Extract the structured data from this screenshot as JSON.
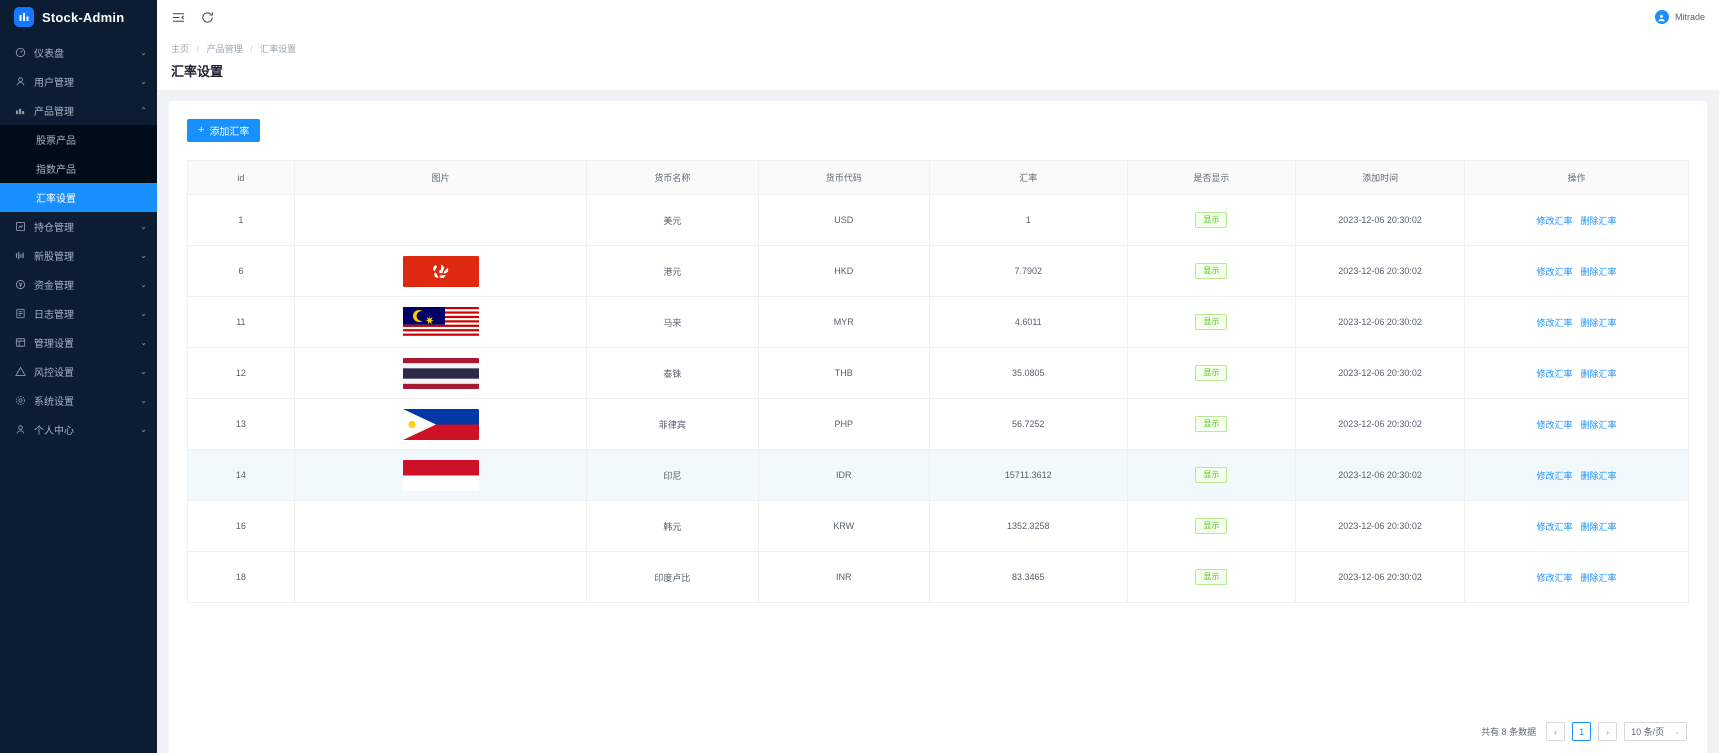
{
  "brand": {
    "name": "Stock-Admin",
    "logo_icon": "chart-logo-icon"
  },
  "sidebar": {
    "items": [
      {
        "label": "仪表盘",
        "icon": "dashboard-icon",
        "arrow": "⌄",
        "expanded": false
      },
      {
        "label": "用户管理",
        "icon": "user-icon",
        "arrow": "⌄",
        "expanded": false
      },
      {
        "label": "产品管理",
        "icon": "product-icon",
        "arrow": "⌃",
        "expanded": true
      },
      {
        "label": "持仓管理",
        "icon": "position-icon",
        "arrow": "⌄",
        "expanded": false
      },
      {
        "label": "新股管理",
        "icon": "ipo-icon",
        "arrow": "⌄",
        "expanded": false
      },
      {
        "label": "资金管理",
        "icon": "fund-icon",
        "arrow": "⌄",
        "expanded": false
      },
      {
        "label": "日志管理",
        "icon": "log-icon",
        "arrow": "⌄",
        "expanded": false
      },
      {
        "label": "管理设置",
        "icon": "manage-icon",
        "arrow": "⌄",
        "expanded": false
      },
      {
        "label": "风控设置",
        "icon": "risk-icon",
        "arrow": "⌄",
        "expanded": false
      },
      {
        "label": "系统设置",
        "icon": "system-icon",
        "arrow": "⌄",
        "expanded": false
      },
      {
        "label": "个人中心",
        "icon": "person-icon",
        "arrow": "⌄",
        "expanded": false
      }
    ],
    "submenu": [
      {
        "label": "股票产品",
        "active": false
      },
      {
        "label": "指数产品",
        "active": false
      },
      {
        "label": "汇率设置",
        "active": true
      }
    ],
    "active_color": "#1890ff"
  },
  "topbar": {
    "collapse_icon": "menu-collapse-icon",
    "refresh_icon": "refresh-icon",
    "user": {
      "name": "Mitrade",
      "avatar_icon": "user-avatar-icon"
    }
  },
  "page": {
    "breadcrumb": [
      "主页",
      "产品管理",
      "汇率设置"
    ],
    "title": "汇率设置"
  },
  "toolbar": {
    "add_label": "添加汇率",
    "add_icon": "plus-icon"
  },
  "table": {
    "columns": [
      "id",
      "图片",
      "货币名称",
      "货币代码",
      "汇率",
      "是否显示",
      "添加时间",
      "操作"
    ],
    "actions": {
      "edit": "修改汇率",
      "delete": "删除汇率"
    },
    "rows": [
      {
        "id": "1",
        "flag": "none",
        "name": "美元",
        "code": "USD",
        "rate": "1",
        "show": "显示",
        "time": "2023-12-06 20:30:02"
      },
      {
        "id": "6",
        "flag": "hk",
        "name": "港元",
        "code": "HKD",
        "rate": "7.7902",
        "show": "显示",
        "time": "2023-12-06 20:30:02"
      },
      {
        "id": "11",
        "flag": "my",
        "name": "马来",
        "code": "MYR",
        "rate": "4.6011",
        "show": "显示",
        "time": "2023-12-06 20:30:02"
      },
      {
        "id": "12",
        "flag": "th",
        "name": "泰铢",
        "code": "THB",
        "rate": "35.0805",
        "show": "显示",
        "time": "2023-12-06 20:30:02"
      },
      {
        "id": "13",
        "flag": "ph",
        "name": "菲律宾",
        "code": "PHP",
        "rate": "56.7252",
        "show": "显示",
        "time": "2023-12-06 20:30:02"
      },
      {
        "id": "14",
        "flag": "id",
        "name": "印尼",
        "code": "IDR",
        "rate": "15711.3612",
        "show": "显示",
        "time": "2023-12-06 20:30:02"
      },
      {
        "id": "16",
        "flag": "none",
        "name": "韩元",
        "code": "KRW",
        "rate": "1352.3258",
        "show": "显示",
        "time": "2023-12-06 20:30:02"
      },
      {
        "id": "18",
        "flag": "none",
        "name": "印度卢比",
        "code": "INR",
        "rate": "83.3465",
        "show": "显示",
        "time": "2023-12-06 20:30:02"
      }
    ]
  },
  "pagination": {
    "total_text": "共有 8 条数据",
    "prev": "‹",
    "next": "›",
    "current_page": "1",
    "page_size": "10 条/页",
    "caret": "⌄"
  },
  "colors": {
    "accent": "#1890ff",
    "sidebar_bg": "#0b1c33",
    "submenu_bg": "#000c17",
    "badge_green": "#52c41a"
  }
}
